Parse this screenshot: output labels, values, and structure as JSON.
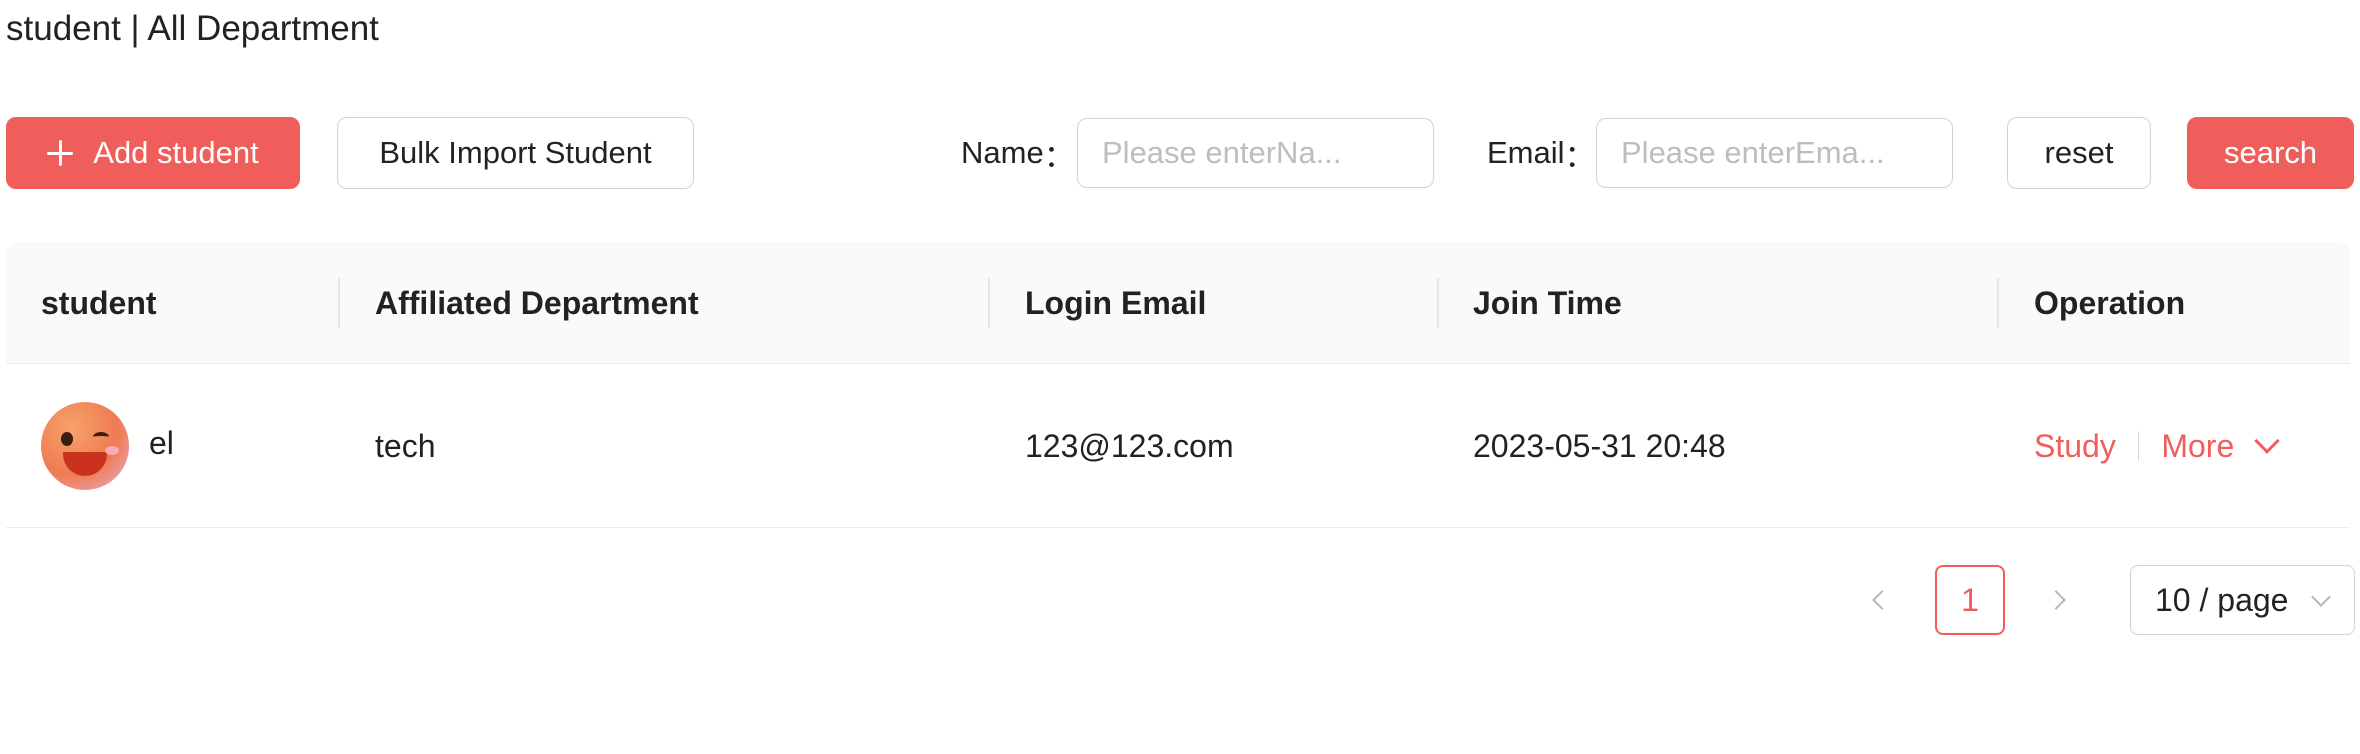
{
  "page": {
    "title": "student | All Department"
  },
  "toolbar": {
    "add_label": "Add student",
    "bulk_import_label": "Bulk Import Student",
    "name_label": "Name",
    "name_placeholder": "Please enterNa...",
    "name_value": "",
    "email_label": "Email",
    "email_placeholder": "Please enterEma...",
    "email_value": "",
    "reset_label": "reset",
    "search_label": "search",
    "label_suffix": "："
  },
  "table": {
    "columns": [
      "student",
      "Affiliated Department",
      "Login Email",
      "Join Time",
      "Operation"
    ],
    "rows": [
      {
        "avatar": "emoji-avatar",
        "student": "el",
        "department": "tech",
        "email": "123@123.com",
        "join_time": "2023-05-31 20:48",
        "actions": [
          "Study",
          "More"
        ]
      }
    ]
  },
  "pagination": {
    "current_page": "1",
    "page_size": "10 / page"
  },
  "colors": {
    "accent": "#ef5e5b",
    "border": "#d3d3d3",
    "header_bg": "#fafafa"
  },
  "icons": {
    "add": "plus-icon",
    "more": "chevron-down-icon",
    "prev": "chevron-left-icon",
    "next": "chevron-right-icon",
    "page_size": "chevron-down-icon"
  }
}
